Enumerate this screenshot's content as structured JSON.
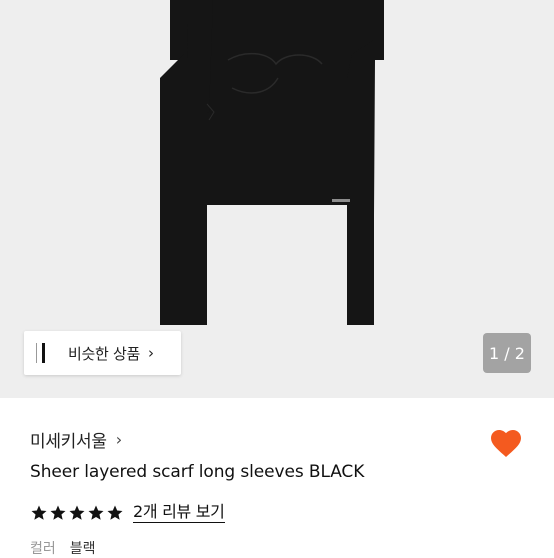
{
  "gallery": {
    "pager": "1 / 2",
    "similar_button": {
      "label": "비슷한 상품",
      "chevron": "›"
    }
  },
  "product": {
    "brand": "미세키서울",
    "brand_chevron": "›",
    "title": "Sheer layered scarf long sleeves BLACK",
    "rating": {
      "stars": 5,
      "review_link": "2개 리뷰 보기"
    },
    "attribute": {
      "label": "컬러",
      "value": "블랙"
    },
    "favorite": {
      "active": true,
      "icon": "heart-icon"
    }
  },
  "colors": {
    "heart": "#f45a1f",
    "garment": "#151515",
    "gallery_bg": "#eeeeee",
    "pager_bg": "#a3a3a3"
  }
}
